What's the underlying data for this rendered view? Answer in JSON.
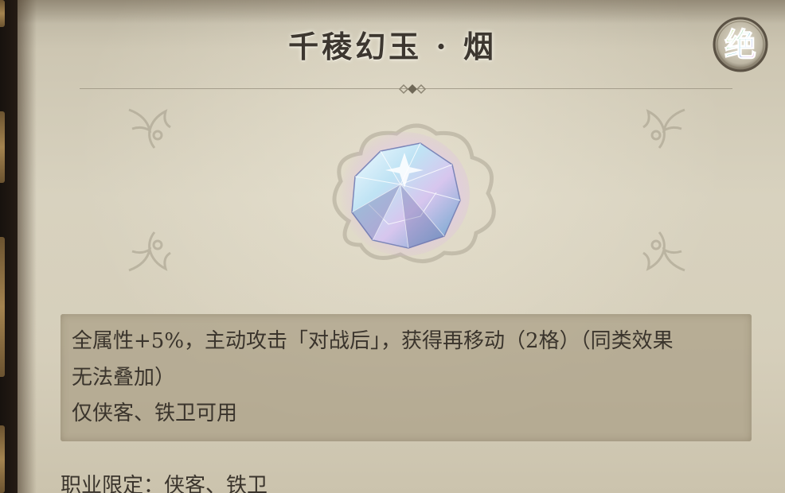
{
  "item": {
    "name": "千稜幻玉 · 烟",
    "rarity_glyph": "绝",
    "description": "全属性+5%，主动攻击「对战后」，获得再移动（2格）（同类效果\n无法叠加）",
    "usage_note": "仅侠客、铁卫可用",
    "class_restriction": "职业限定：侠客、铁卫"
  },
  "colors": {
    "text": "#3a342c",
    "parchment": "#d8d2bf",
    "desc_box": "#aaa087"
  },
  "icons": {
    "rarity": "rarity-badge-icon",
    "gem": "gem-icon",
    "corner": "fleur-ornament-icon",
    "cloud": "cloud-pattern-icon"
  }
}
